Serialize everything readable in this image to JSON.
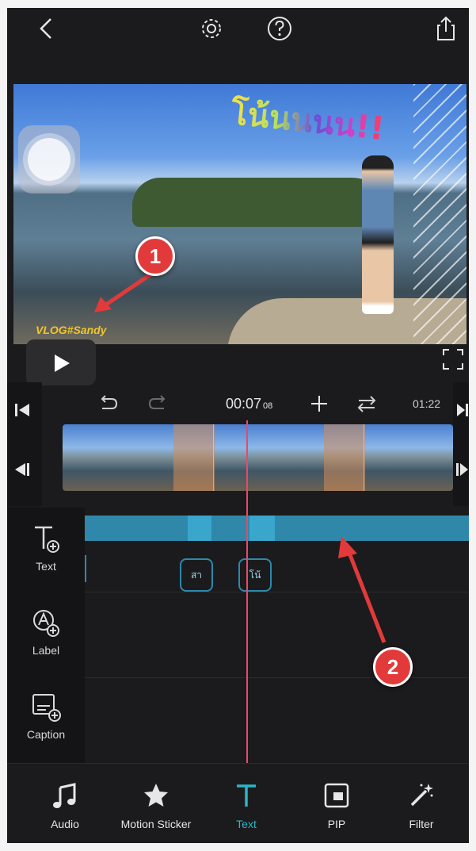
{
  "preview": {
    "overlay_text": "โน้นนนน!!",
    "watermark": "VLOG#Sandy"
  },
  "timeline": {
    "current_time": "00:07",
    "current_frames": "08",
    "total_time": "01:22"
  },
  "layers": {
    "tools": [
      {
        "label": "Text",
        "icon": "text-add-icon"
      },
      {
        "label": "Label",
        "icon": "label-add-icon"
      },
      {
        "label": "Caption",
        "icon": "caption-add-icon"
      }
    ],
    "text_chips": [
      "สา",
      "โน้"
    ]
  },
  "annotations": {
    "marker_1": "1",
    "marker_2": "2"
  },
  "tabs": [
    {
      "label": "Audio",
      "icon": "music-note-icon"
    },
    {
      "label": "Motion Sticker",
      "icon": "star-sticker-icon"
    },
    {
      "label": "Text",
      "icon": "text-icon",
      "active": true
    },
    {
      "label": "PIP",
      "icon": "pip-icon"
    },
    {
      "label": "Filter",
      "icon": "magic-wand-icon"
    }
  ],
  "colors": {
    "accent": "#29b6c8",
    "playhead": "#e8496a",
    "track": "#2f88aa",
    "marker": "#e23a3a"
  }
}
